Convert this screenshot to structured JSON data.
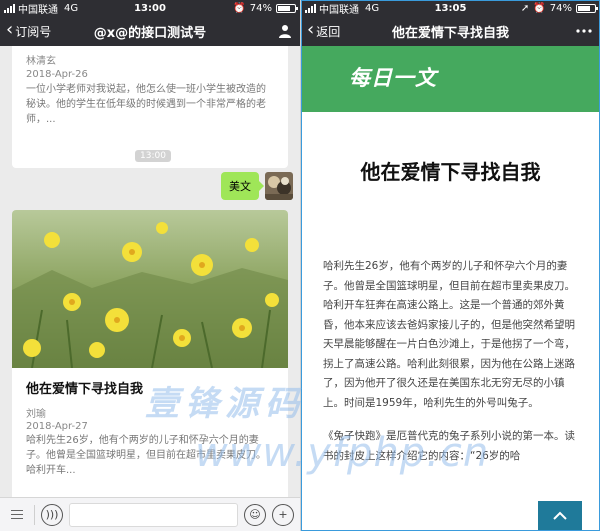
{
  "left": {
    "status": {
      "carrier": "中国联通",
      "network": "4G",
      "time": "13:00",
      "battery": "74%",
      "battery_level": 0.74
    },
    "nav": {
      "back_label": "订阅号",
      "title": "@x@的接口测试号"
    },
    "top_card": {
      "author": "林清玄",
      "date": "2018-Apr-26",
      "summary": "一位小学老师对我说起，他怎么使一班小学生被改造的秘诀。他的学生在低年级的时候遇到一个非常严格的老师，..."
    },
    "time_chip": "13:00",
    "message": {
      "text": "美文"
    },
    "article_card": {
      "title": "他在爱情下寻找自我",
      "author": "刘瑜",
      "date": "2018-Apr-27",
      "summary": "哈利先生26岁，他有个两岁的儿子和怀孕六个月的妻子。他曾是全国篮球明星，但目前在超市里卖果皮刀。哈利开车..."
    }
  },
  "right": {
    "status": {
      "carrier": "中国联通",
      "network": "4G",
      "time": "13:05",
      "battery": "74%",
      "battery_level": 0.74
    },
    "nav": {
      "back_label": "返回",
      "title": "他在爱情下寻找自我"
    },
    "banner_text": "每日一文",
    "article": {
      "title": "他在爱情下寻找自我",
      "para1": "哈利先生26岁，他有个两岁的儿子和怀孕六个月的妻子。他曾是全国篮球明星，但目前在超市里卖果皮刀。哈利开车狂奔在高速公路上。这是一个普通的郊外黄昏，他本来应该去爸妈家接儿子的，但是他突然希望明天早晨能够醒在一片白色沙滩上，于是他拐了一个弯，拐上了高速公路。哈利此刻很累，因为他在公路上迷路了，因为他开了很久还是在美国东北无穷无尽的小镇上。时间是1959年，哈利先生的外号叫兔子。",
      "para2": "《兔子快跑》是厄普代克的兔子系列小说的第一本。读书的封皮上这样介绍它的内容：“26岁的哈"
    }
  },
  "watermark": {
    "cn": "壹锋源码",
    "en": "www.yfphp.cn"
  },
  "colors": {
    "banner": "#45a95e",
    "bubble": "#9fe658",
    "nav": "#2e2e33",
    "scroll_top": "#1f7a9a"
  }
}
